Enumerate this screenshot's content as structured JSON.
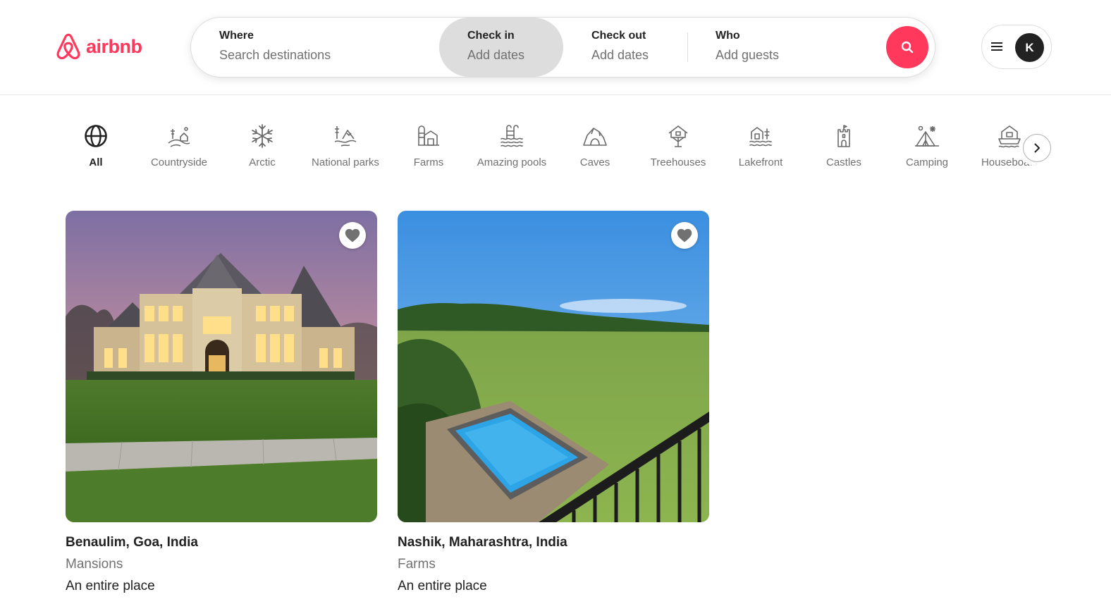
{
  "brand": {
    "name": "airbnb",
    "color": "#ff385c"
  },
  "search": {
    "where": {
      "label": "Where",
      "placeholder": "Search destinations"
    },
    "checkin": {
      "label": "Check in",
      "placeholder": "Add dates"
    },
    "checkout": {
      "label": "Check out",
      "placeholder": "Add dates"
    },
    "who": {
      "label": "Who",
      "placeholder": "Add guests"
    },
    "button_icon": "search-icon"
  },
  "user": {
    "avatar_initial": "K",
    "menu_icon": "hamburger-icon"
  },
  "categories": [
    {
      "label": "All",
      "icon": "globe-icon",
      "active": true
    },
    {
      "label": "Countryside",
      "icon": "countryside-icon"
    },
    {
      "label": "Arctic",
      "icon": "snowflake-icon"
    },
    {
      "label": "National parks",
      "icon": "national-park-icon"
    },
    {
      "label": "Farms",
      "icon": "farm-icon"
    },
    {
      "label": "Amazing pools",
      "icon": "pool-icon"
    },
    {
      "label": "Caves",
      "icon": "cave-icon"
    },
    {
      "label": "Treehouses",
      "icon": "treehouse-icon"
    },
    {
      "label": "Lakefront",
      "icon": "lakefront-icon"
    },
    {
      "label": "Castles",
      "icon": "castle-icon"
    },
    {
      "label": "Camping",
      "icon": "camping-icon"
    },
    {
      "label": "Houseboats",
      "icon": "houseboat-icon"
    }
  ],
  "listings": [
    {
      "location": "Benaulim, Goa, India",
      "category": "Mansions",
      "type": "An entire place",
      "image": "mansion-photo"
    },
    {
      "location": "Nashik, Maharashtra, India",
      "category": "Farms",
      "type": "An entire place",
      "image": "farm-pool-photo"
    }
  ]
}
